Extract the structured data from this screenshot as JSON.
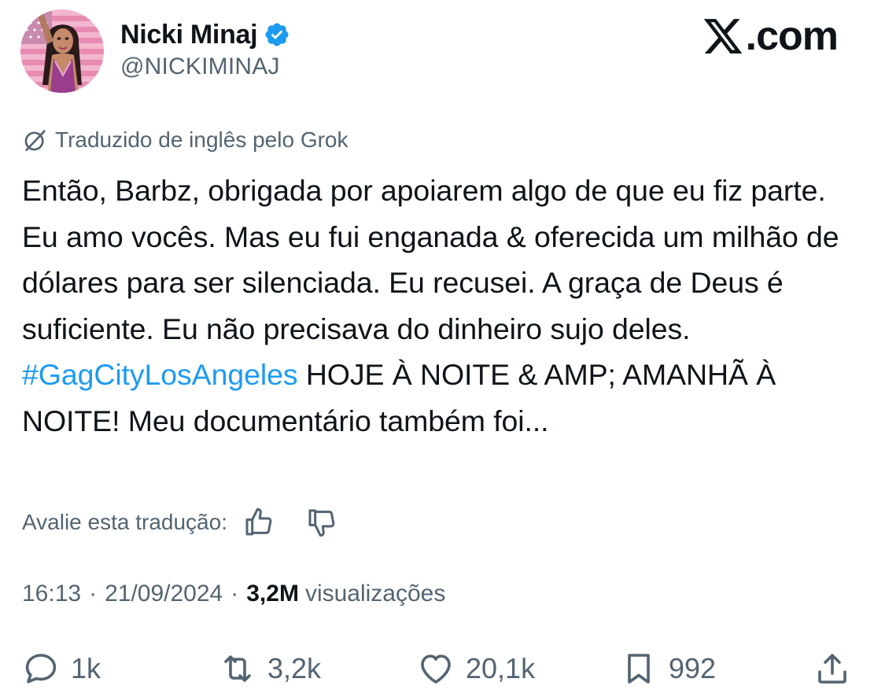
{
  "author": {
    "name": "Nicki Minaj",
    "handle": "@NICKIMINAJ",
    "verified": true
  },
  "brand": {
    "logo_text": ".com",
    "logo_icon": "x-logo-icon"
  },
  "translation_notice": "Traduzido de inglês pelo Grok",
  "tweet": {
    "text_before": "Então, Barbz, obrigada por apoiarem algo de que eu fiz parte. Eu amo vocês. Mas eu fui enganada & oferecida um milhão de dólares para ser silenciada. Eu recusei. A graça de Deus é suficiente. Eu não precisava do dinheiro sujo deles. ",
    "hashtag": "#GagCityLosAngeles",
    "text_after": " HOJE À NOITE & AMP; AMANHÃ À NOITE! Meu documentário também foi..."
  },
  "rate_translation": {
    "label": "Avalie esta tradução:",
    "thumbs_up_icon": "thumbs-up-icon",
    "thumbs_down_icon": "thumbs-down-icon"
  },
  "meta": {
    "time": "16:13",
    "sep1": "·",
    "date": "21/09/2024",
    "sep2": "·",
    "views_count": "3,2M",
    "views_label": "visualizações"
  },
  "actions": {
    "replies": "1k",
    "reposts": "3,2k",
    "likes": "20,1k",
    "bookmarks": "992"
  },
  "colors": {
    "text": "#0f1419",
    "secondary": "#536471",
    "hashtag": "#1d9bf0",
    "verified": "#1d9bf0"
  }
}
